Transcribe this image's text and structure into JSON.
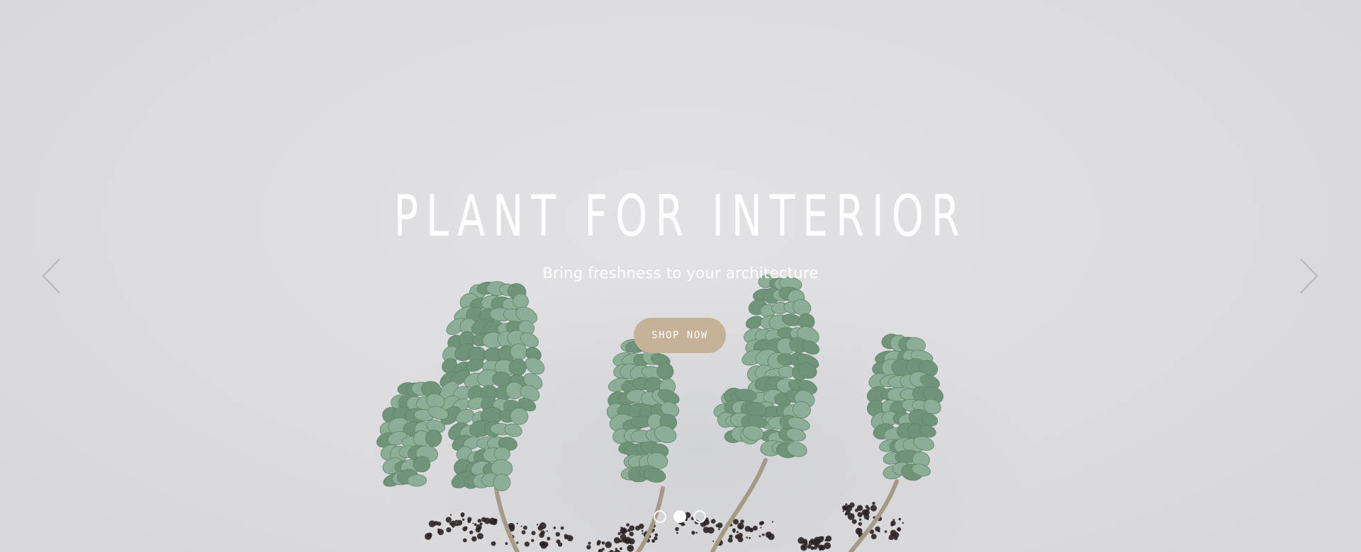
{
  "hero": {
    "title": "PLANT FOR INTERIOR",
    "subtitle": "Bring freshness to your architecture",
    "cta_label": "SHOP NOW"
  },
  "navigation": {
    "prev_icon": "chevron-left-icon",
    "next_icon": "chevron-right-icon"
  },
  "pagination": {
    "total": 3,
    "active_index": 1
  },
  "image": {
    "subject": "succulent-plants"
  },
  "colors": {
    "background": "#dcdcdf",
    "text": "#ffffff",
    "button": "#c7b196",
    "leaf": "#8cae96",
    "leaf_dark": "#6f9479",
    "soil": "#2b2322",
    "stem": "#a59a86"
  }
}
